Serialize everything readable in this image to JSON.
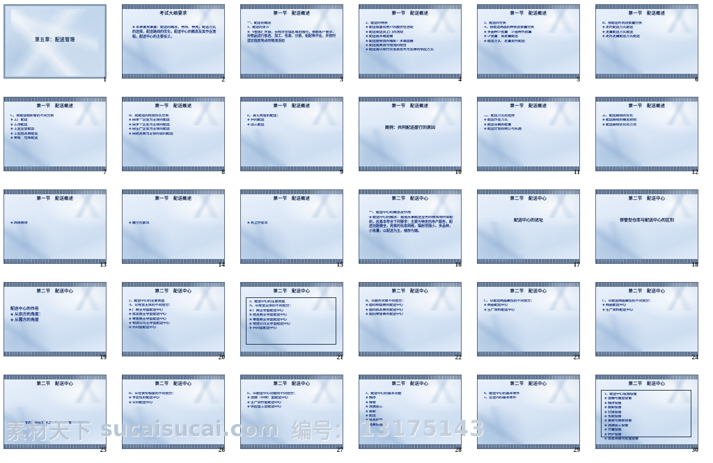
{
  "document": {
    "kind": "powerpoint-handout-contact-sheet",
    "columns": 6,
    "rows": 5,
    "accent_color": "#16307c",
    "title_color": "#11254a",
    "slide_bg": "#dce6f4",
    "page_bg": "#ffffff"
  },
  "watermark": {
    "brand_cn": "素材天下",
    "url": "sucaisucai.com",
    "id_label": "编号：",
    "id_value": "13175143"
  },
  "slides": [
    {
      "number": "1",
      "layout": "title",
      "title": "第五章：配送管理",
      "lines": []
    },
    {
      "number": "2",
      "layout": "paragraph",
      "title": "考试大纲要求",
      "lines": [
        "◈ 本章重点掌握：配送的概念、特点、种类，配送方式的选择，配送路线的优化，配送中心的概念及其作业流程，配送中心的主要设工。"
      ]
    },
    {
      "number": "3",
      "layout": "bullets",
      "title": "第一节　配送概述",
      "lines": [
        "一、配送的概述",
        "1、配送的定义",
        "◈ 《物流》术语，在经济合理区域范围内，根据客户要求，对物品进行拣选、加工、包装、分割、组配等作业，并按时送达指定地点的物流活动"
      ]
    },
    {
      "number": "4",
      "layout": "bullets",
      "title": "第一节　配送概述",
      "lines": [
        "2、配送的特点",
        "◈ 配送是面向用户的服务性活动",
        "◈ 配送是送货上门的活动",
        "◈ 配送是末端运输",
        "◈ 配送是物流的缩影／末端运输",
        "◈ 配送是商流与物流的结合",
        "◈ 配送是以现代化信息技术为支撑的供应方式"
      ]
    },
    {
      "number": "5",
      "layout": "bullets",
      "title": "第一节　配送概述",
      "lines": [
        "3、配送的分类",
        "A、按配送商品的种类及数量分类",
        "◈ 多品种少批量　少品种大批量",
        "◈ 少批量　成批量配送",
        "◈ 配送方式　定量定时配送"
      ]
    },
    {
      "number": "6",
      "layout": "bullets",
      "title": "第一节　配送概述",
      "lines": [
        "B、按配送时间及数量分类",
        "◈ 定时配送方式配送",
        "◈ 定量配送方式配送",
        "◈ 定时定量配送方式配送"
      ]
    },
    {
      "number": "7",
      "layout": "bullets",
      "title": "第一节　配送概述",
      "lines": [
        "C、按配送组织者的不同分类",
        "◈ 工厂配送",
        "◈ 工场配送",
        "◈ 工业企业配送",
        "◈ 工业批发商配送",
        "◈ 零售　仓库配送"
      ]
    },
    {
      "number": "8",
      "layout": "bullets",
      "title": "第一节　配送概述",
      "lines": [
        "D、按配送的经营形式分类",
        "◈ 由单一企业为主体的配送",
        "◈ 由多个企业为主体的配送",
        "◈ 由生产企业为主体的配送",
        "◈ 由批发商为主体的协同配送"
      ]
    },
    {
      "number": "9",
      "layout": "bullets",
      "title": "第一节　配送概述",
      "lines": [
        "E、其它类型的配送：",
        "◈ 共同配送",
        "◈ 加工配送"
      ]
    },
    {
      "number": "10",
      "layout": "centered",
      "title": "第一节　配送概述",
      "lines": [
        "案例：共同配送盛行的原因"
      ]
    },
    {
      "number": "11",
      "layout": "bullets",
      "title": "第一节　配送概述",
      "lines": [
        "二、配送方式的选择",
        "◈ 配送作业方式",
        "◈ 配送车辆的配置",
        "◈ 配送计划的制订与实施"
      ]
    },
    {
      "number": "12",
      "layout": "bullets",
      "title": "第一节　配送概述",
      "lines": [
        "三、配送路线的优化",
        "◈ 配送路线的确定原则",
        "◈ 配送路线优化的方法"
      ]
    },
    {
      "number": "13",
      "layout": "bullets-sparse",
      "title": "第一节　配送概述",
      "lines": [
        "◈ 西单商场"
      ]
    },
    {
      "number": "14",
      "layout": "bullets-sparse",
      "title": "第一节　配送概述",
      "lines": [
        "◈ 最小元素法"
      ]
    },
    {
      "number": "15",
      "layout": "bullets-sparse",
      "title": "第一节　配送概述",
      "lines": [
        "◈ 表上作业法"
      ]
    },
    {
      "number": "16",
      "layout": "paragraph",
      "title": "第二节　配送中心",
      "lines": [
        "一、配送中心的概念及作用",
        "◈ 配送中心的概念：是指从事配送业务的物流场所或组织，应基本符合下列要求：主要为特定的用户服务，配送功能健全，完善的信息网络，辐射范围小，多品种，小批量，以配送为主，储存为辅。"
      ]
    },
    {
      "number": "17",
      "layout": "centered",
      "title": "第二节　配送中心",
      "lines": [
        "配送中心的述址"
      ]
    },
    {
      "number": "18",
      "layout": "centered",
      "title": "第二节　配送中心",
      "lines": [
        "保管型仓库与配送中心的区别"
      ]
    },
    {
      "number": "19",
      "layout": "bullets-large",
      "title": "第二节　配送中心",
      "lines": [
        "配送中心的作用",
        "◈ 从供方的角度：",
        "◈ 从需方的角度"
      ]
    },
    {
      "number": "20",
      "layout": "bullets",
      "title": "第二节　配送中心",
      "lines": [
        "2、配送中心的主要类型",
        "A、以经营主体的不同划分：",
        "◈ 厂商主导型配送中心",
        "◈ 批发商主导型配送中心",
        "◈ 零售商主导型配送中心",
        "◈ 物流公司主导型配送中心",
        "◈ 共同型配送中心"
      ]
    },
    {
      "number": "21",
      "layout": "bullets-boxed",
      "title": "第二节　配送中心",
      "lines": [
        "2、配送中心的主要类型",
        "A、以经营主体的不同划分：",
        "◈ 厂商主导型配送中心",
        "◈ 批发商主导型配送中心",
        "◈ 零售商主导型配送中心",
        "◈ 物流公司主导型配送中心",
        "◈ 共同型配送中心"
      ]
    },
    {
      "number": "22",
      "layout": "bullets",
      "title": "第二节　配送中心",
      "lines": [
        "B、以服务对象不同划分：",
        "◈ 面向制造商的配送中心",
        "◈ 面向批发商的配送中心",
        "◈ 面向零售商的配送中心"
      ]
    },
    {
      "number": "23",
      "layout": "bullets",
      "title": "第二节　配送中心",
      "lines": [
        "C、以配送商品属性的不同划分：",
        "◈ 商品配送中心",
        "◈ 生产资料配送中心"
      ]
    },
    {
      "number": "24",
      "layout": "bullets",
      "title": "第二节　配送中心",
      "lines": [
        "C、以配送商品属性的不同划分：",
        "◈ 商品配送中心",
        "◈ 生产资料配送中心"
      ]
    },
    {
      "number": "25",
      "layout": "bullets-low",
      "title": "第二节　配送中心",
      "lines": [
        "支援、美国沃尔玛在全球上与配送中心管理二种模式"
      ]
    },
    {
      "number": "26",
      "layout": "bullets",
      "title": "第二节　配送中心",
      "lines": [
        "D、以社会化程度的不同划分：",
        "◈ 专业性的配送中心",
        "◈ 公共配送中心"
      ]
    },
    {
      "number": "27",
      "layout": "bullets",
      "title": "第二节　配送中心",
      "lines": [
        "E、以配送中心功能的不同划分：",
        "◈ 流通（中转）型配送中心",
        "◈ 生产协作型配送中心",
        "◈ 供应型工业配送中心"
      ]
    },
    {
      "number": "28",
      "layout": "bullets",
      "title": "第二节　配送中心",
      "lines": [
        "3、配送中心的基本功能",
        "◈ 储存",
        "◈ 保管",
        "◈ 流通加工",
        "◈ 装卸",
        "◈ 配送",
        "◈ 信息处理",
        "◈ 结算处理"
      ]
    },
    {
      "number": "29",
      "layout": "bullets",
      "title": "第二节　配送中心",
      "lines": [
        "4、配送中心的基本条件",
        "5、企业内的基本条件"
      ]
    },
    {
      "number": "30",
      "layout": "bullets-boxed",
      "title": "第二节　配送中心",
      "lines": [
        "1、配送中心设施设备",
        "◈ 运输与搬运设备",
        "◈ 储存设备",
        "◈ 装卸设备",
        "◈ 分拣设备",
        "◈ 包装设备",
        "◈ 集装与集装设备",
        "◈ 流通加工设备",
        "◈ 计量设备",
        "◈ 养护设备",
        "◈ 信息采集与处理设备"
      ]
    }
  ]
}
